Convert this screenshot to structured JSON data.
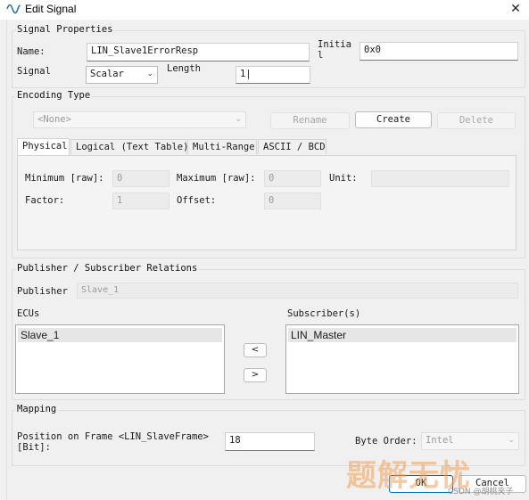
{
  "window": {
    "title": "Edit Signal",
    "close_glyph": "✕",
    "icon": "sine-wave-icon"
  },
  "signal_properties": {
    "group_title": "Signal Properties",
    "name_label": "Name:",
    "name_value": "LIN_Slave1ErrorResp",
    "initial_label_line1": "Initia",
    "initial_label_line2": "l",
    "initial_value": "0x0",
    "signal_label": "Signal",
    "signal_type": "Scalar",
    "length_label": "Length",
    "length_value": "1|"
  },
  "encoding_type": {
    "group_title": "Encoding Type",
    "select_value": "<None>",
    "rename_label": "Rename",
    "create_label": "Create",
    "delete_label": "Delete",
    "tabs": [
      "Physical",
      "Logical (Text Table)",
      "Multi-Range",
      "ASCII / BCD"
    ],
    "minimum_label": "Minimum [raw]:",
    "minimum_value": "0",
    "maximum_label": "Maximum [raw]:",
    "maximum_value": "0",
    "unit_label": "Unit:",
    "unit_value": "",
    "factor_label": "Factor:",
    "factor_value": "1",
    "offset_label": "Offset:",
    "offset_value": "0"
  },
  "relations": {
    "group_title": "Publisher / Subscriber Relations",
    "publisher_label": "Publisher",
    "publisher_value": "Slave_1",
    "ecus_label": "ECUs",
    "ecus_items": [
      "Slave_1"
    ],
    "subscribers_label": "Subscriber(s)",
    "subscribers_items": [
      "LIN_Master"
    ],
    "move_left_glyph": "<",
    "move_right_glyph": ">"
  },
  "mapping": {
    "group_title": "Mapping",
    "position_label_line1": "Position on Frame <LIN_SlaveFrame>",
    "position_label_line2": "[Bit]:",
    "position_value": "18",
    "byte_order_label": "Byte Order:",
    "byte_order_value": "Intel"
  },
  "footer": {
    "ok_label": "OK",
    "cancel_label": "Cancel"
  },
  "watermark": {
    "main": "题解无忧",
    "sub": "CSDN @胡桃夹子"
  },
  "colors": {
    "accent": "#0067c0",
    "watermark": "#f0a05a"
  }
}
